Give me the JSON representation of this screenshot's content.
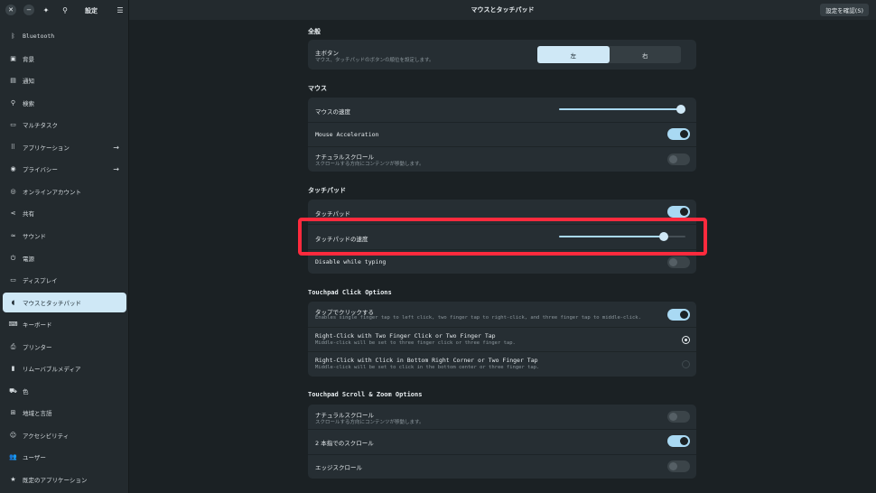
{
  "window": {
    "sidebar_title": "設定",
    "main_title": "マウスとタッチパッド",
    "confirm_button": "設定を確認(S)"
  },
  "sidebar": {
    "items": [
      {
        "label": "Bluetooth",
        "icon": "bluetooth-icon"
      },
      {
        "label": "背景",
        "icon": "background-icon"
      },
      {
        "label": "通知",
        "icon": "notification-icon"
      },
      {
        "label": "検索",
        "icon": "search-icon"
      },
      {
        "label": "マルチタスク",
        "icon": "multitask-icon"
      },
      {
        "label": "アプリケーション",
        "icon": "apps-icon",
        "arrow": true
      },
      {
        "label": "プライバシー",
        "icon": "privacy-icon",
        "arrow": true
      },
      {
        "label": "オンラインアカウント",
        "icon": "online-accounts-icon"
      },
      {
        "label": "共有",
        "icon": "share-icon"
      },
      {
        "label": "サウンド",
        "icon": "sound-icon"
      },
      {
        "label": "電源",
        "icon": "power-icon"
      },
      {
        "label": "ディスプレイ",
        "icon": "display-icon"
      },
      {
        "label": "マウスとタッチパッド",
        "icon": "mouse-icon",
        "active": true
      },
      {
        "label": "キーボード",
        "icon": "keyboard-icon"
      },
      {
        "label": "プリンター",
        "icon": "printer-icon"
      },
      {
        "label": "リムーバブルメディア",
        "icon": "removable-media-icon"
      },
      {
        "label": "色",
        "icon": "color-icon"
      },
      {
        "label": "地域と言語",
        "icon": "region-icon"
      },
      {
        "label": "アクセシビリティ",
        "icon": "accessibility-icon"
      },
      {
        "label": "ユーザー",
        "icon": "users-icon"
      },
      {
        "label": "既定のアプリケーション",
        "icon": "default-apps-icon"
      }
    ]
  },
  "general": {
    "title": "全般",
    "primary_button": {
      "title": "主ボタン",
      "subtitle": "マウス、タッチパッドのボタンの順位を設定します。",
      "left": "左",
      "right": "右",
      "selected": "左"
    }
  },
  "mouse": {
    "title": "マウス",
    "speed_label": "マウスの速度",
    "speed_value": 1.0,
    "acceleration_label": "Mouse Acceleration",
    "acceleration_on": true,
    "natural_scroll_label": "ナチュラルスクロール",
    "natural_scroll_sub": "スクロールする方向にコンテンツが移動します。",
    "natural_scroll_on": false
  },
  "touchpad": {
    "title": "タッチパッド",
    "enabled_label": "タッチパッド",
    "enabled_on": true,
    "speed_label": "タッチパッドの速度",
    "speed_value": 0.85,
    "disable_typing_label": "Disable while typing",
    "disable_typing_on": false
  },
  "click_options": {
    "title": "Touchpad Click Options",
    "tap_label": "タップでクリックする",
    "tap_sub": "Enables single finger tap to left click, two finger tap to right-click, and three finger tap to middle-click.",
    "tap_on": true,
    "two_finger_label": "Right-Click with Two Finger Click or Two Finger Tap",
    "two_finger_sub": "Middle-click will be set to three finger click or three finger tap.",
    "corner_label": "Right-Click with Click in Bottom Right Corner or Two Finger Tap",
    "corner_sub": "Middle-click will be set to click in the bottom center or three finger tap."
  },
  "scroll_options": {
    "title": "Touchpad Scroll & Zoom Options",
    "natural_label": "ナチュラルスクロール",
    "natural_sub": "スクロールする方向にコンテンツが移動します。",
    "natural_on": false,
    "two_finger_label": "2 本指でのスクロール",
    "two_finger_on": true,
    "edge_label": "エッジスクロール",
    "edge_on": false
  },
  "colors": {
    "accent": "#a9d9f3",
    "highlight": "#ff2a3d",
    "background": "#1b2124",
    "card": "#262e33"
  }
}
